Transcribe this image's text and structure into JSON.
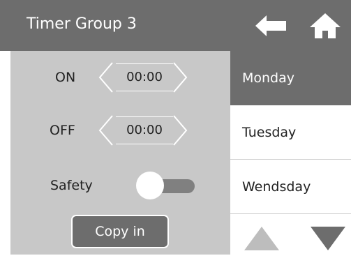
{
  "header": {
    "title": "Timer Group 3",
    "back_icon": "arrow-left-icon",
    "home_icon": "home-icon"
  },
  "timer": {
    "on_label": "ON",
    "on_time": "00:00",
    "off_label": "OFF",
    "off_time": "00:00"
  },
  "safety": {
    "label": "Safety",
    "enabled": false
  },
  "copy_button": "Copy in",
  "days": [
    "Monday",
    "Tuesday",
    "Wendsday"
  ],
  "selected_day": "Monday",
  "colors": {
    "header": "#6d6d6d",
    "panel": "#c8c8c8",
    "text": "#222222",
    "nav_arrow": "#bdbdbd",
    "nav_arrow_active": "#6d6d6d"
  }
}
